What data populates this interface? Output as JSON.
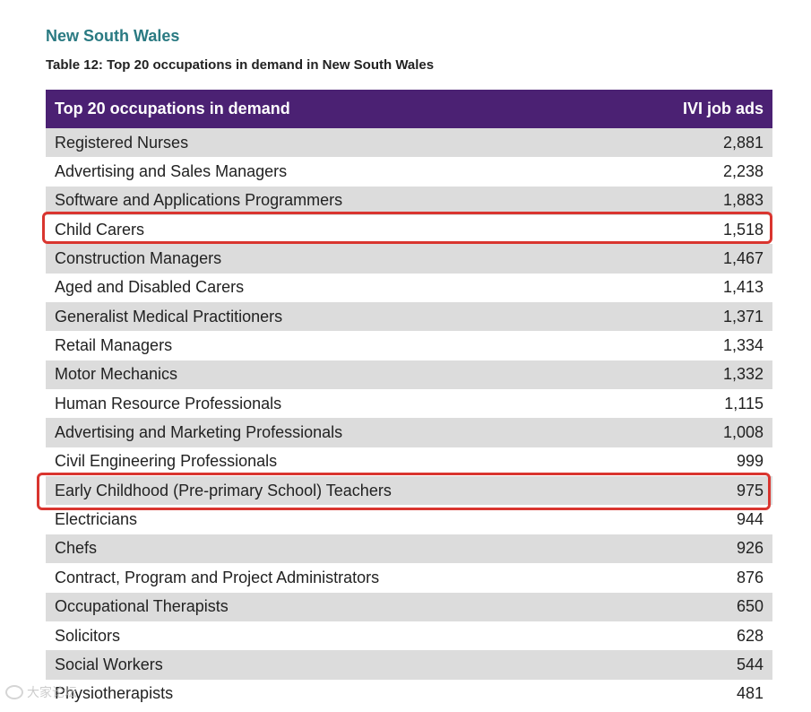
{
  "section_title": "New South Wales",
  "caption": "Table 12: Top 20 occupations in demand in New South Wales",
  "table": {
    "headers": [
      "Top 20 occupations in demand",
      "IVI job ads"
    ],
    "rows": [
      [
        "Registered Nurses",
        "2,881"
      ],
      [
        "Advertising and Sales Managers",
        "2,238"
      ],
      [
        "Software and Applications Programmers",
        "1,883"
      ],
      [
        "Child Carers",
        "1,518"
      ],
      [
        "Construction Managers",
        "1,467"
      ],
      [
        "Aged and Disabled Carers",
        "1,413"
      ],
      [
        "Generalist Medical Practitioners",
        "1,371"
      ],
      [
        "Retail Managers",
        "1,334"
      ],
      [
        "Motor Mechanics",
        "1,332"
      ],
      [
        "Human Resource Professionals",
        "1,115"
      ],
      [
        "Advertising and Marketing Professionals",
        "1,008"
      ],
      [
        "Civil Engineering Professionals",
        "999"
      ],
      [
        "Early Childhood (Pre-primary School) Teachers",
        "975"
      ],
      [
        "Electricians",
        "944"
      ],
      [
        "Chefs",
        "926"
      ],
      [
        "Contract, Program and Project Administrators",
        "876"
      ],
      [
        "Occupational Therapists",
        "650"
      ],
      [
        "Solicitors",
        "628"
      ],
      [
        "Social Workers",
        "544"
      ],
      [
        "Physiotherapists",
        "481"
      ]
    ]
  },
  "highlight_color": "#d9352f",
  "header_color": "#4b2173",
  "watermark": {
    "text": "大家论坛",
    "icon": "watermark-logo-icon"
  }
}
